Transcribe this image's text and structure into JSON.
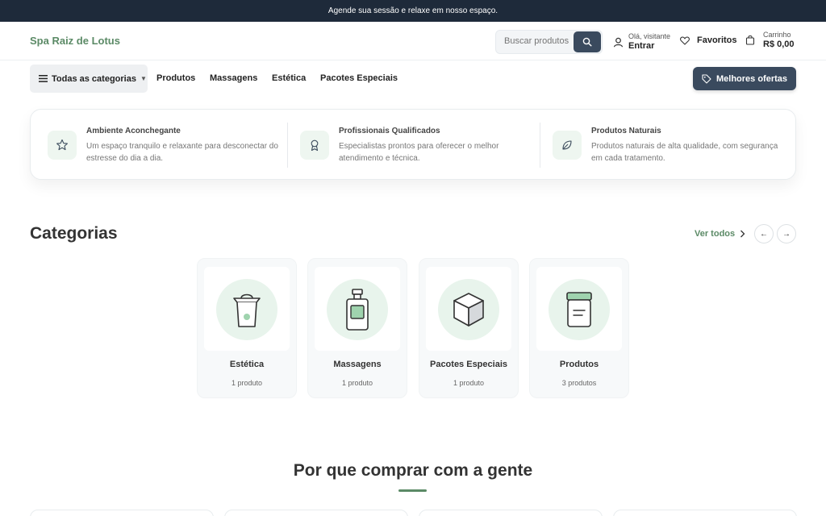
{
  "announcement": "Agende sua sessão e relaxe em nosso espaço.",
  "header": {
    "logo": "Spa Raiz de Lotus",
    "search_placeholder": "Buscar produtos",
    "user_greeting": "Olá, visitante",
    "user_action": "Entrar",
    "favorites": "Favoritos",
    "cart_label": "Carrinho",
    "cart_total": "R$ 0,00"
  },
  "nav": {
    "all_categories": "Todas as categorias",
    "links": [
      "Produtos",
      "Massagens",
      "Estética",
      "Pacotes Especiais"
    ],
    "deals": "Melhores ofertas"
  },
  "features": [
    {
      "icon": "star-icon",
      "title": "Ambiente Aconchegante",
      "desc": "Um espaço tranquilo e relaxante para desconectar do estresse do dia a dia."
    },
    {
      "icon": "award-icon",
      "title": "Profissionais Qualificados",
      "desc": "Especialistas prontos para oferecer o melhor atendimento e técnica."
    },
    {
      "icon": "leaf-icon",
      "title": "Produtos Naturais",
      "desc": "Produtos naturais de alta qualidade, com segurança em cada tratamento."
    }
  ],
  "categories": {
    "title": "Categorias",
    "see_all": "Ver todos",
    "prev": "←",
    "next": "→",
    "items": [
      {
        "name": "Estética",
        "count": "1 produto",
        "icon": "bag-icon"
      },
      {
        "name": "Massagens",
        "count": "1 produto",
        "icon": "bottle-icon"
      },
      {
        "name": "Pacotes Especiais",
        "count": "1 produto",
        "icon": "box-icon"
      },
      {
        "name": "Produtos",
        "count": "3 produtos",
        "icon": "jar-icon"
      }
    ]
  },
  "why": {
    "title": "Por que comprar com a gente"
  },
  "colors": {
    "brand": "#5b8a66",
    "dark": "#1e2a3a",
    "button": "#3a4a5e"
  }
}
